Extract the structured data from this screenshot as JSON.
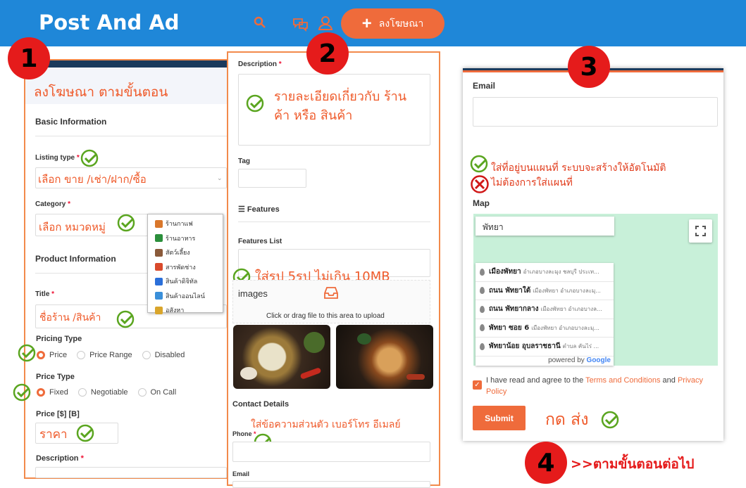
{
  "topbar": {
    "logo": "Post And Ad",
    "post_button_label": "ลงโฆษณา"
  },
  "badges": [
    "1",
    "2",
    "3",
    "4"
  ],
  "panel1": {
    "header_title": "ลงโฆษณา ตามขั้นตอน",
    "basic_info_heading": "Basic Information",
    "listing_type_label": "Listing type",
    "listing_type_value": "เลือก ขาย /เช่า/ฝาก/ซื้อ",
    "category_label": "Category",
    "category_value": "เลือก หมวดหมู่",
    "product_info_heading": "Product Information",
    "title_label": "Title",
    "title_value": "ชื่อร้าน /สินค้า",
    "pricing_type_label": "Pricing Type",
    "pricing_options": [
      "Price",
      "Price Range",
      "Disabled"
    ],
    "price_type_label": "Price Type",
    "price_type_options": [
      "Fixed",
      "Negotiable",
      "On Call"
    ],
    "price_label": "Price [$] [B]",
    "price_value": "ราคา",
    "description_label": "Description",
    "required_mark": "*"
  },
  "category_popup": {
    "items": [
      "ร้านกาแฟ",
      "ร้านอาหาร",
      "สัตว์เลี้ยง",
      "สารพัดช่าง",
      "สินค้าดิจิทัล",
      "สินค้าออนไลน์",
      "อสังหา"
    ],
    "colors": [
      "#d9772b",
      "#2b8f3b",
      "#8a5a3a",
      "#d94a2b",
      "#2b6fd9",
      "#3a8fd9",
      "#d9a52b"
    ]
  },
  "panel2": {
    "description_label": "Description",
    "description_note": "รายละเอียดเกี่ยวกับ ร้านค้า หรือ สินค้า",
    "tag_label": "Tag",
    "features_heading": "Features",
    "features_list_label": "Features List",
    "images_note": "ใส่รูป 5รูป ไม่เกิน 10MB",
    "images_label": "images",
    "upload_hint": "Click or drag file to this area to upload",
    "contact_heading": "Contact Details",
    "contact_note": "ใส่ข้อความส่วนตัว เบอร์โทร อีเมลย์",
    "phone_label": "Phone",
    "email_label": "Email"
  },
  "panel3": {
    "email_label": "Email",
    "map_note_yes": "ใส่ที่อยู่บนแผนที่ ระบบจะสร้างให้อัตโนมัติ",
    "map_note_no": "ไม่ต้องการใส่แผนที่",
    "map_label": "Map",
    "map_search_value": "พัทยา",
    "suggestions": [
      {
        "main": "เมืองพัทยา",
        "sub": "อำเภอบางละมุง ชลบุรี ประเท..."
      },
      {
        "main": "ถนน พัทยาใต้",
        "sub": "เมืองพัทยา อำเภอบางละมุ..."
      },
      {
        "main": "ถนน พัทยากลาง",
        "sub": "เมืองพัทยา อำเภอบางล..."
      },
      {
        "main": "พัทยา ซอย 6",
        "sub": "เมืองพัทยา อำเภอบางละมุ..."
      },
      {
        "main": "พัทยาน้อย อุบลราชธานี",
        "sub": "ตำบล คันไร่ ..."
      }
    ],
    "powered_by": "powered by",
    "google": "Google",
    "agree_text_1": "I have read and agree to the",
    "terms_link": "Terms and Conditions",
    "agree_and": "and",
    "privacy_link": "Privacy Policy",
    "submit_label": "Submit",
    "submit_note": "กด ส่ง"
  },
  "step4_note": ">>ตามขั้นตอนต่อไป",
  "colors": {
    "topbar": "#1f87d8",
    "accent": "#ef6b3b",
    "badge": "#e51b1b",
    "check": "#5aa51f",
    "cross": "#d01818"
  }
}
